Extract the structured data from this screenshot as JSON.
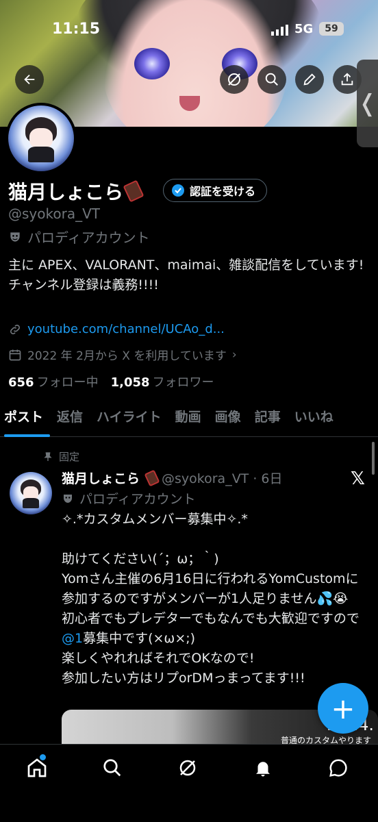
{
  "status_bar": {
    "time": "11:15",
    "network": "5G",
    "battery": "59"
  },
  "profile": {
    "name": "猫月しょこら",
    "verify_label": "認証を受ける",
    "handle": "@syokora_VT",
    "parody_label": "パロディアカウント",
    "bio": "主に APEX、VALORANT、maimai、雑談配信をしています!\nチャンネル登録は義務!!!!",
    "link": "youtube.com/channel/UCAo_d...",
    "joined": "2022 年 2月から X を利用しています",
    "following_count": "656",
    "following_label": "フォロー中",
    "followers_count": "1,058",
    "followers_label": "フォロワー"
  },
  "tabs": [
    {
      "label": "ポスト",
      "active": true
    },
    {
      "label": "返信",
      "active": false
    },
    {
      "label": "ハイライト",
      "active": false
    },
    {
      "label": "動画",
      "active": false
    },
    {
      "label": "画像",
      "active": false
    },
    {
      "label": "記事",
      "active": false
    },
    {
      "label": "いいね",
      "active": false
    }
  ],
  "post": {
    "pinned_label": "固定",
    "author_name": "猫月しょこら",
    "meta": "@syokora_VT · 6日",
    "parody_label": "パロディアカウント",
    "text_1": "✧.*カスタムメンバー募集中✧.*\n\n助けてください(´；ω；｀)\nYomさん主催の6月16日に行われるYomCustomに参加するのですがメンバーが1人足りません💦😭\n初心者でもプレデターでもなんでも大歓迎ですので",
    "mention": "@1",
    "text_2": "募集中です(×ω×;)\n楽しくやれればそれでOKなので!\n参加したい方はリプorDMっまってます!!!",
    "media_year": "2024.",
    "media_subtitle": "普通のカスタムやります"
  },
  "fab_label": "+",
  "icons": {
    "back": "arrow-left-icon",
    "grok": "grok-icon",
    "search": "search-icon",
    "edit": "pencil-icon",
    "share": "share-icon",
    "link": "link-icon",
    "calendar": "calendar-icon",
    "pin": "pin-icon",
    "x_logo": "x-logo-icon",
    "nav": [
      "home-icon",
      "search-icon",
      "grok-icon",
      "bell-icon",
      "messages-icon"
    ]
  },
  "colors": {
    "accent": "#1d9bf0",
    "background": "#000000",
    "muted": "#71767b"
  }
}
